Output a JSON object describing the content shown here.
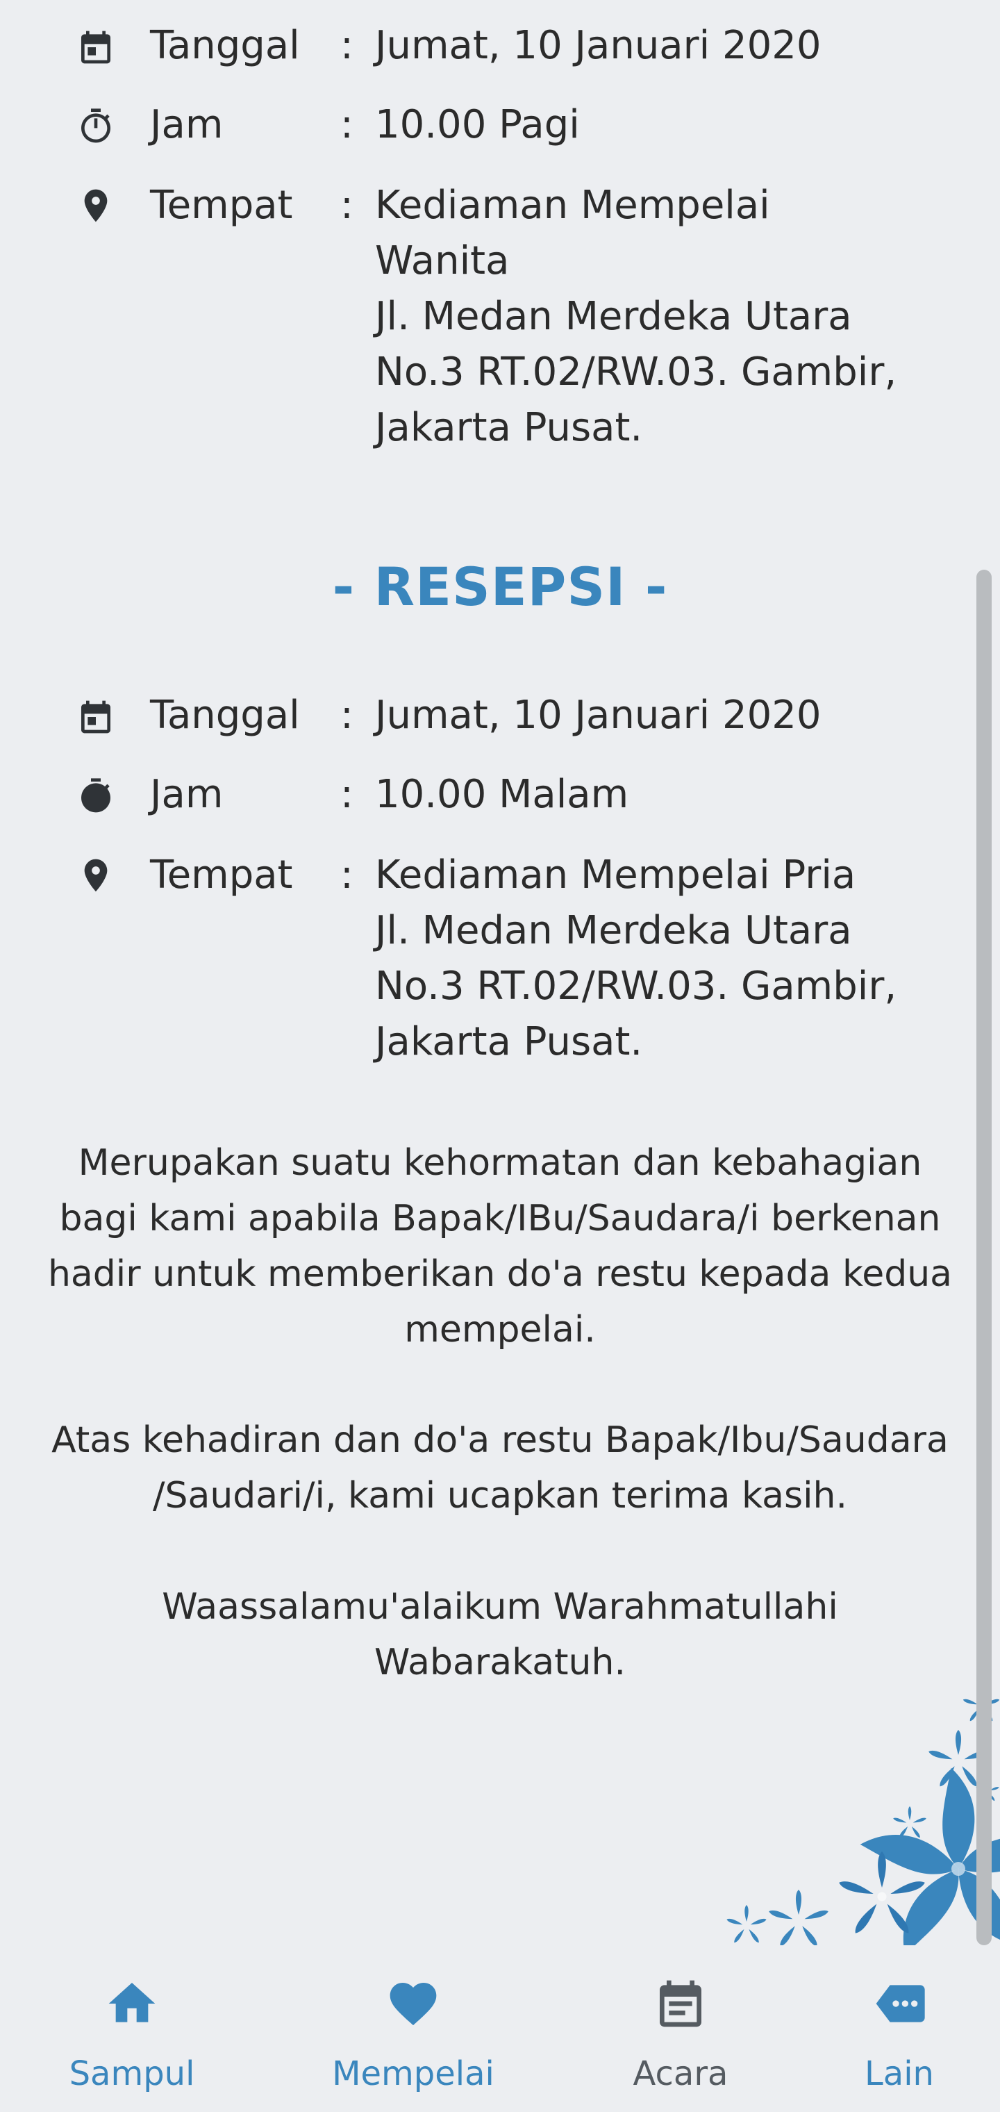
{
  "akad": {
    "rows": [
      {
        "icon": "calendar-icon",
        "label": "Tanggal",
        "colon": ":",
        "lines": [
          "Jumat, 10 Januari 2020"
        ]
      },
      {
        "icon": "stopwatch-icon",
        "label": "Jam",
        "colon": ":",
        "lines": [
          "10.00 Pagi"
        ]
      },
      {
        "icon": "location-pin-icon",
        "label": "Tempat",
        "colon": ":",
        "lines": [
          "Kediaman Mempelai",
          "Wanita",
          "Jl. Medan Merdeka Utara",
          "No.3 RT.02/RW.03. Gambir,",
          "Jakarta Pusat."
        ]
      }
    ]
  },
  "resepsi": {
    "title": "- RESEPSI -",
    "rows": [
      {
        "icon": "calendar-icon",
        "label": "Tanggal",
        "colon": ":",
        "lines": [
          "Jumat, 10 Januari 2020"
        ]
      },
      {
        "icon": "stopwatch-icon",
        "label": "Jam",
        "colon": ":",
        "lines": [
          "10.00 Malam"
        ]
      },
      {
        "icon": "location-pin-icon",
        "label": "Tempat",
        "colon": ":",
        "lines": [
          "Kediaman Mempelai Pria",
          "Jl. Medan Merdeka Utara",
          "No.3 RT.02/RW.03. Gambir,",
          "Jakarta Pusat."
        ]
      }
    ]
  },
  "closing": {
    "paragraph1": [
      "Merupakan suatu kehormatan dan kebahagian",
      "bagi kami apabila Bapak/IBu/Saudara/i berkenan",
      "hadir untuk memberikan do'a restu kepada kedua",
      "mempelai."
    ],
    "paragraph2": [
      "Atas kehadiran dan do'a restu Bapak/Ibu/Saudara",
      "/Saudari/i, kami ucapkan terima kasih."
    ],
    "paragraph3": [
      "Waassalamu'alaikum Warahmatullahi",
      "Wabarakatuh."
    ]
  },
  "nav": {
    "items": [
      {
        "label": "Sampul",
        "icon": "home-icon",
        "active": true
      },
      {
        "label": "Mempelai",
        "icon": "heart-icon",
        "active": true
      },
      {
        "label": "Acara",
        "icon": "event-calendar-icon",
        "active": false
      },
      {
        "label": "Lain",
        "icon": "more-chat-icon",
        "active": true
      }
    ]
  },
  "colors": {
    "accent": "#3a86bd",
    "text": "#2b2b2b",
    "inactive_nav": "#555b61",
    "background": "#eceef1"
  }
}
